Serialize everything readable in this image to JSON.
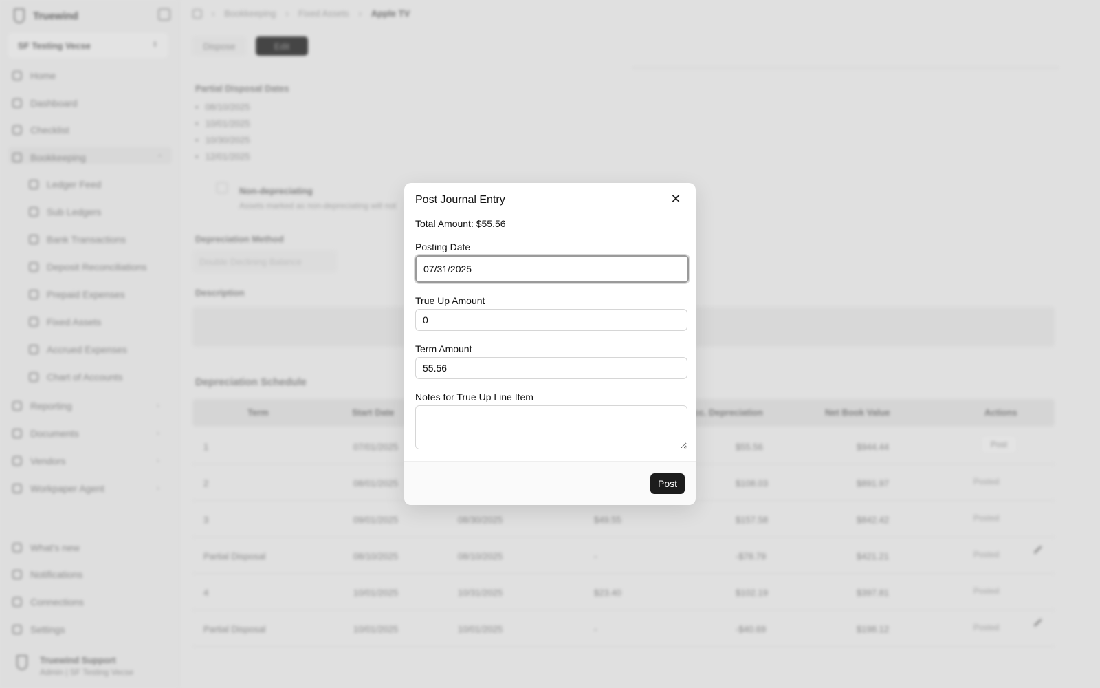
{
  "sidebar": {
    "brand": "Truewind",
    "workspace": "SF Testing Vecse",
    "items": [
      {
        "label": "Home"
      },
      {
        "label": "Dashboard"
      },
      {
        "label": "Checklist"
      },
      {
        "label": "Bookkeeping"
      }
    ],
    "sub_items": [
      {
        "label": "Ledger Feed"
      },
      {
        "label": "Sub Ledgers"
      },
      {
        "label": "Bank Transactions"
      },
      {
        "label": "Deposit Reconciliations"
      },
      {
        "label": "Prepaid Expenses"
      },
      {
        "label": "Fixed Assets"
      },
      {
        "label": "Accrued Expenses"
      },
      {
        "label": "Chart of Accounts"
      }
    ],
    "more_items": [
      {
        "label": "Reporting"
      },
      {
        "label": "Documents"
      },
      {
        "label": "Vendors"
      },
      {
        "label": "Workpaper Agent"
      }
    ],
    "bottom_items": [
      {
        "label": "What's new"
      },
      {
        "label": "Notifications"
      },
      {
        "label": "Connections"
      },
      {
        "label": "Settings"
      }
    ],
    "user": {
      "name": "Truewind Support",
      "role": "Admin | SF Testing Vecse"
    }
  },
  "breadcrumb": {
    "items": [
      "Bookkeeping",
      "Fixed Assets"
    ],
    "current": "Apple TV"
  },
  "tabs": {
    "dispose": "Dispose",
    "active": "Edit"
  },
  "page": {
    "partial_dates_label": "Partial Disposal Dates",
    "partial_dates": [
      "08/10/2025",
      "10/01/2025",
      "10/30/2025",
      "12/01/2025"
    ],
    "non_depreciating_label": "Non-depreciating",
    "non_depreciating_sub": "Assets marked as non-depreciating will not",
    "depreciation_method_label": "Depreciation Method",
    "depreciation_method_value": "Double Declining Balance",
    "description_label": "Description",
    "schedule_title": "Depreciation Schedule"
  },
  "table": {
    "headers": [
      "Term",
      "Start Date",
      "Acc. Depreciation",
      "Net Book Value",
      "Actions"
    ],
    "rows": [
      {
        "term": "1",
        "start": "07/01/2025",
        "end": "",
        "amount": "",
        "acc": "$55.56",
        "nbv": "$944.44",
        "action": "Post",
        "edit": false
      },
      {
        "term": "2",
        "start": "08/01/2025",
        "end": "",
        "amount": "",
        "acc": "$108.03",
        "nbv": "$891.97",
        "action": "Posted",
        "edit": false
      },
      {
        "term": "3",
        "start": "09/01/2025",
        "end": "08/30/2025",
        "amount": "$49.55",
        "acc": "$157.58",
        "nbv": "$842.42",
        "action": "Posted",
        "edit": false
      },
      {
        "term": "Partial Disposal",
        "start": "08/10/2025",
        "end": "08/10/2025",
        "amount": "-",
        "acc": "-$78.79",
        "nbv": "$421.21",
        "action": "Posted",
        "edit": true
      },
      {
        "term": "4",
        "start": "10/01/2025",
        "end": "10/31/2025",
        "amount": "$23.40",
        "acc": "$102.19",
        "nbv": "$397.81",
        "action": "Posted",
        "edit": false
      },
      {
        "term": "Partial Disposal",
        "start": "10/01/2025",
        "end": "10/01/2025",
        "amount": "-",
        "acc": "-$40.69",
        "nbv": "$198.12",
        "action": "Posted",
        "edit": true
      }
    ]
  },
  "modal": {
    "title": "Post Journal Entry",
    "total": "Total Amount: $55.56",
    "posting_date_label": "Posting Date",
    "posting_date_value": "07/31/2025",
    "true_up_label": "True Up Amount",
    "true_up_value": "0",
    "term_amount_label": "Term Amount",
    "term_amount_value": "55.56",
    "notes_label": "Notes for True Up Line Item",
    "notes_value": "",
    "post_button": "Post",
    "close_glyph": "✕"
  }
}
